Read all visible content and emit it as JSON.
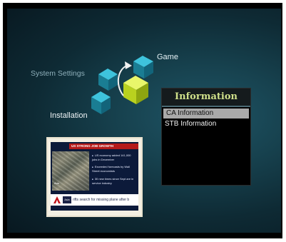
{
  "menu": {
    "system_settings": "System Settings",
    "game": "Game",
    "installation": "Installation"
  },
  "info_panel": {
    "title": "Information",
    "items": [
      {
        "label": "CA Information",
        "selected": true
      },
      {
        "label": "STB Information",
        "selected": false
      }
    ]
  },
  "preview": {
    "headline": "US STRONG JOB GROWTH",
    "bullets": [
      "US economy added 141,000 jobs in December",
      "Exceeded forecasts by Wall Street economists",
      "30 new times since Sept are in service industry"
    ],
    "photo_caption": "Aus",
    "ticker_box": "Asia",
    "ticker": "rifts search for missing plane after b"
  },
  "colors": {
    "background": "#17424f",
    "cube_cyan": "#1e8ea6",
    "cube_selected": "#c6e02a",
    "panel_title": "#cfe08a",
    "selection_bar": "#a9a9a9",
    "headline_red": "#b51a1a"
  },
  "icons": {
    "cube_menu": "rotating-cube-menu-icon",
    "rotation_arrow": "rotate-arrow-icon",
    "news_logo": "news-channel-logo"
  }
}
